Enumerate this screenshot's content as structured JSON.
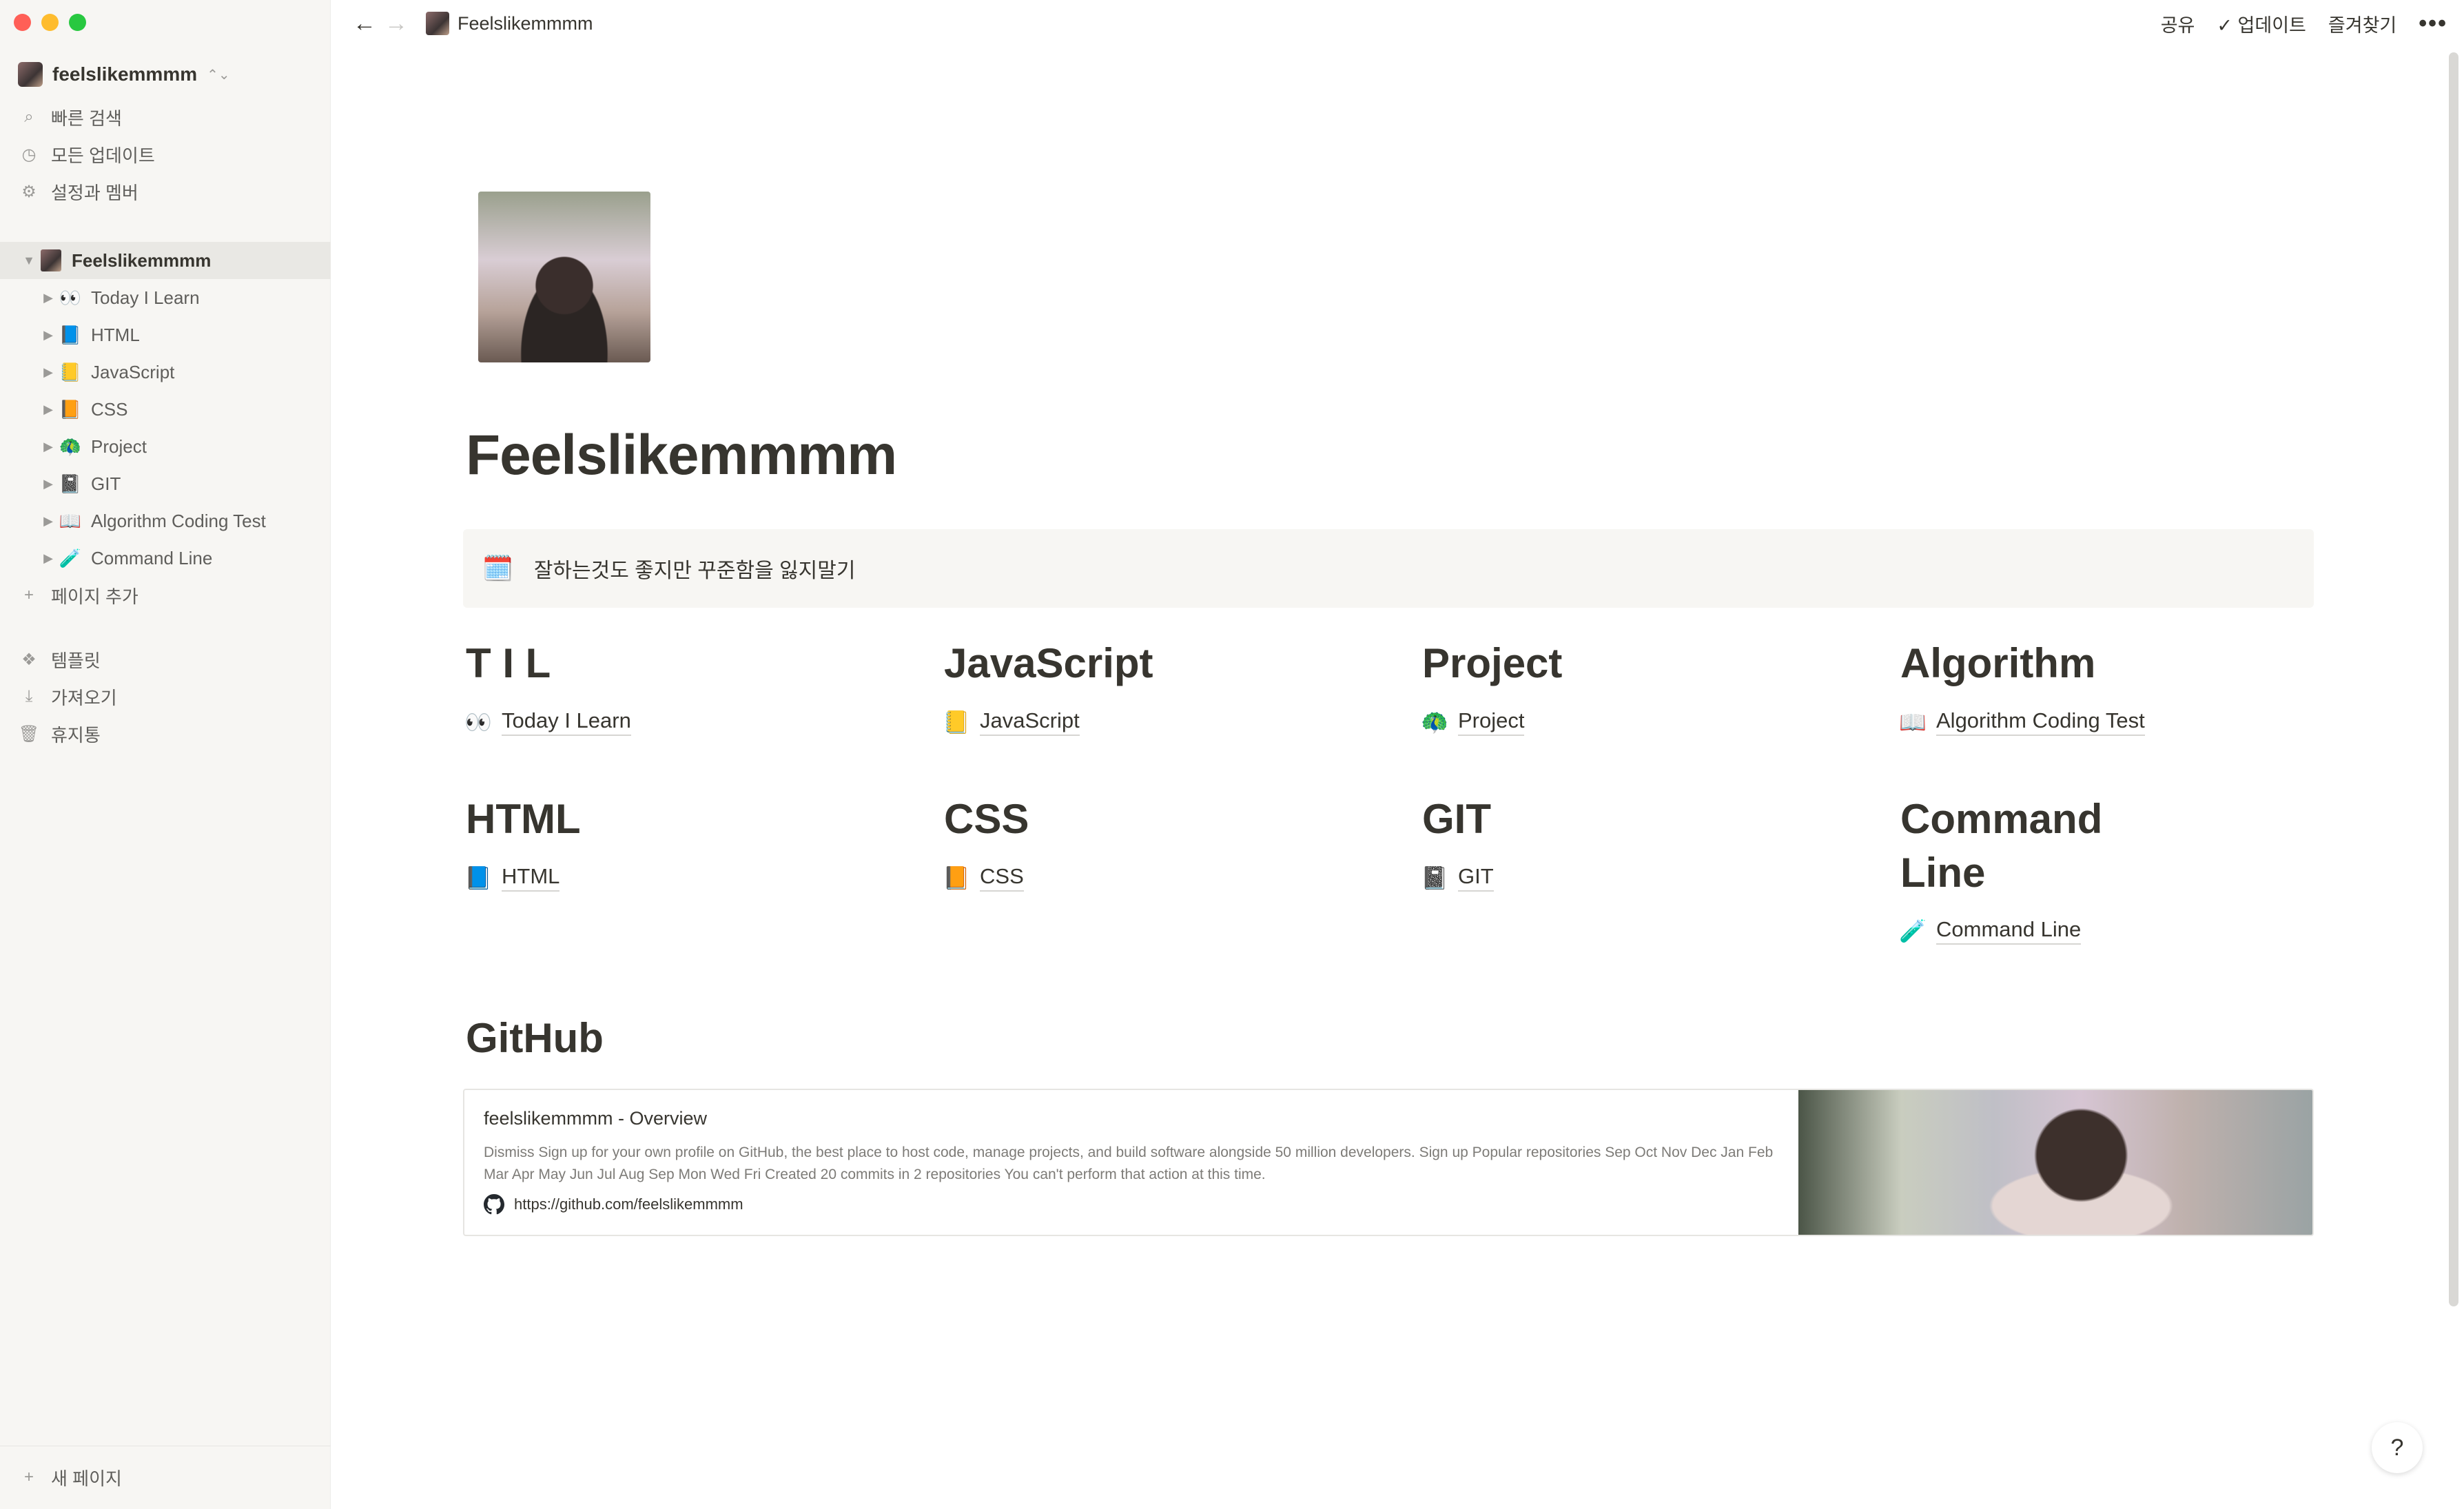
{
  "window": {
    "traffic_lights": [
      "#ff5f57",
      "#febc2e",
      "#28c840"
    ]
  },
  "sidebar": {
    "workspace_name": "feelslikemmmm",
    "top_items": [
      {
        "icon": "search-icon",
        "glyph": "⌕",
        "label": "빠른 검색"
      },
      {
        "icon": "clock-icon",
        "glyph": "◷",
        "label": "모든 업데이트"
      },
      {
        "icon": "gear-icon",
        "glyph": "⚙",
        "label": "설정과 멤버"
      }
    ],
    "root_page": "Feelslikemmmm",
    "pages": [
      {
        "emoji": "👀",
        "label": "Today I Learn"
      },
      {
        "emoji": "📘",
        "label": "HTML"
      },
      {
        "emoji": "📒",
        "label": "JavaScript"
      },
      {
        "emoji": "📙",
        "label": "CSS"
      },
      {
        "emoji": "🦚",
        "label": "Project"
      },
      {
        "emoji": "📓",
        "label": "GIT"
      },
      {
        "emoji": "📖",
        "label": "Algorithm Coding Test"
      },
      {
        "emoji": "🧪",
        "label": "Command Line"
      }
    ],
    "add_page": "페이지 추가",
    "bottom_items": [
      {
        "icon": "template-icon",
        "glyph": "❖",
        "label": "템플릿"
      },
      {
        "icon": "import-icon",
        "glyph": "⤓",
        "label": "가져오기"
      },
      {
        "icon": "trash-icon",
        "glyph": "🗑",
        "label": "휴지통"
      }
    ],
    "new_page": "새 페이지"
  },
  "topbar": {
    "breadcrumb": "Feelslikemmmm",
    "share": "공유",
    "updates": "업데이트",
    "favorite": "즐겨찾기",
    "more": "•••"
  },
  "page": {
    "title": "Feelslikemmmm",
    "callout_icon": "🗓️",
    "callout_text": "잘하는것도 좋지만 꾸준함을 잃지말기",
    "columns": [
      {
        "heading": "T I L",
        "emoji": "👀",
        "link": "Today I Learn"
      },
      {
        "heading": "JavaScript",
        "emoji": "📒",
        "link": "JavaScript"
      },
      {
        "heading": "Project",
        "emoji": "🦚",
        "link": "Project"
      },
      {
        "heading": "Algorithm",
        "emoji": "📖",
        "link": "Algorithm Coding Test"
      },
      {
        "heading": "HTML",
        "emoji": "📘",
        "link": "HTML"
      },
      {
        "heading": "CSS",
        "emoji": "📙",
        "link": "CSS"
      },
      {
        "heading": "GIT",
        "emoji": "📓",
        "link": "GIT"
      },
      {
        "heading": "Command Line",
        "emoji": "🧪",
        "link": "Command Line"
      }
    ],
    "github_heading": "GitHub",
    "bookmark": {
      "title": "feelslikemmmm - Overview",
      "description": "Dismiss Sign up for your own profile on GitHub, the best place to host code, manage projects, and build software alongside 50 million developers. Sign up Popular repositories Sep Oct Nov Dec Jan Feb Mar Apr May Jun Jul Aug Sep Mon Wed Fri Created 20 commits in 2 repositories You can't perform that action at this time.",
      "url": "https://github.com/feelslikemmmm"
    },
    "help": "?"
  }
}
